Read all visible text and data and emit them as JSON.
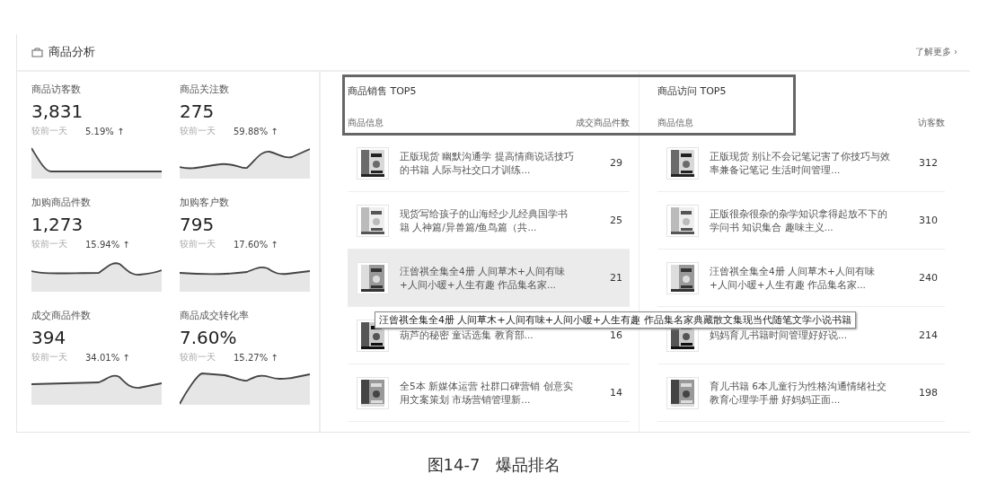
{
  "panel": {
    "title": "商品分析",
    "more_link": "了解更多 ›"
  },
  "metrics": [
    {
      "label": "商品访客数",
      "value": "3,831",
      "compare_label": "较前一天",
      "change": "5.19% ↑"
    },
    {
      "label": "商品关注数",
      "value": "275",
      "compare_label": "较前一天",
      "change": "59.88% ↑"
    },
    {
      "label": "加购商品件数",
      "value": "1,273",
      "compare_label": "较前一天",
      "change": "15.94% ↑"
    },
    {
      "label": "加购客户数",
      "value": "795",
      "compare_label": "较前一天",
      "change": "17.60% ↑"
    },
    {
      "label": "成交商品件数",
      "value": "394",
      "compare_label": "较前一天",
      "change": "34.01% ↑"
    },
    {
      "label": "商品成交转化率",
      "value": "7.60%",
      "compare_label": "较前一天",
      "change": "15.27% ↑"
    }
  ],
  "rankings": [
    {
      "title": "商品销售 TOP5",
      "columns": [
        "商品信息",
        "成交商品件数"
      ],
      "items": [
        {
          "name": "正版现货 幽默沟通学 提高情商说话技巧的书籍 人际与社交口才训练...",
          "count": "29",
          "highlighted": false
        },
        {
          "name": "现货写给孩子的山海经少儿经典国学书籍 人神篇/异兽篇/鱼鸟篇（共...",
          "count": "25",
          "highlighted": false
        },
        {
          "name": "汪曾祺全集全4册 人间草木+人间有味+人间小暖+人生有趣 作品集名家...",
          "count": "21",
          "highlighted": true
        },
        {
          "name": "葫芦的秘密 童话选集 教育部...",
          "count": "16",
          "highlighted": false
        },
        {
          "name": "全5本 新媒体运营 社群口碑营销 创意实用文案策划 市场营销管理新...",
          "count": "14",
          "highlighted": false
        }
      ]
    },
    {
      "title": "商品访问 TOP5",
      "columns": [
        "商品信息",
        "访客数"
      ],
      "items": [
        {
          "name": "正版现货 别让不会记笔记害了你技巧与效率兼备记笔记 生活时间管理...",
          "count": "312",
          "highlighted": false
        },
        {
          "name": "正版很杂很杂的杂学知识拿得起放不下的学问书 知识集合 趣味主义...",
          "count": "310",
          "highlighted": false
        },
        {
          "name": "汪曾祺全集全4册 人间草木+人间有味+人间小暖+人生有趣 作品集名家...",
          "count": "240",
          "highlighted": false
        },
        {
          "name": "妈妈育儿书籍时间管理好好说...",
          "count": "214",
          "highlighted": false
        },
        {
          "name": "育儿书籍 6本儿童行为性格沟通情绪社交教育心理学手册 好妈妈正面...",
          "count": "198",
          "highlighted": false
        }
      ]
    }
  ],
  "tooltip": "汪曾祺全集全4册 人间草木+人间有味+人间小暖+人生有趣 作品集名家典藏散文集现当代随笔文学小说书籍",
  "caption": "图14-7　爆品排名"
}
